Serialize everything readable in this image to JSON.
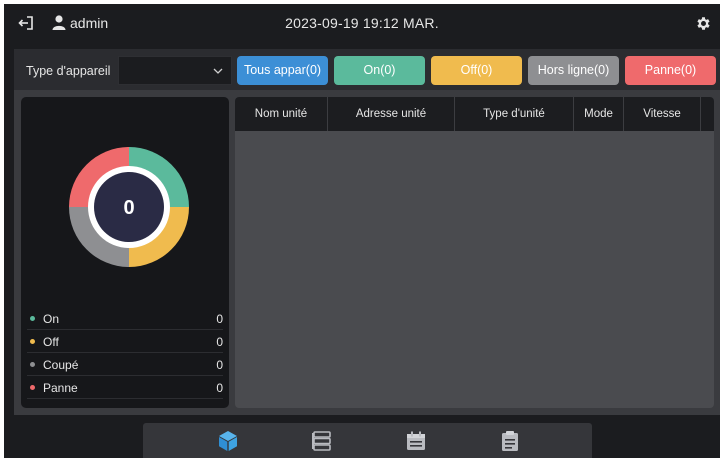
{
  "header": {
    "username": "admin",
    "datetime": "2023-09-19 19:12 MAR."
  },
  "filter": {
    "type_label": "Type d'appareil",
    "type_value": "",
    "buttons": {
      "all": "Tous appar(0)",
      "on": "On(0)",
      "off": "Off(0)",
      "offline": "Hors ligne(0)",
      "fault": "Panne(0)"
    }
  },
  "summary": {
    "total": "0",
    "legend": [
      {
        "label": "On",
        "value": "0",
        "color": "#5bba9c"
      },
      {
        "label": "Off",
        "value": "0",
        "color": "#f0bb4e"
      },
      {
        "label": "Coupé",
        "value": "0",
        "color": "#8e8f92"
      },
      {
        "label": "Panne",
        "value": "0",
        "color": "#ef6a6c"
      }
    ]
  },
  "table": {
    "columns": [
      "Nom unité",
      "Adresse unité",
      "Type d'unité",
      "Mode",
      "Vitesse"
    ]
  },
  "colors": {
    "accent_blue": "#3c8fd6",
    "on_green": "#5bba9c",
    "off_yellow": "#f0bb4e",
    "offline_grey": "#8e8f92",
    "fault_red": "#ef6a6c",
    "donut_center": "#2a2b45"
  },
  "nav": {
    "icons": [
      "cube-icon",
      "list-stack-icon",
      "calendar-icon",
      "clipboard-icon"
    ]
  }
}
